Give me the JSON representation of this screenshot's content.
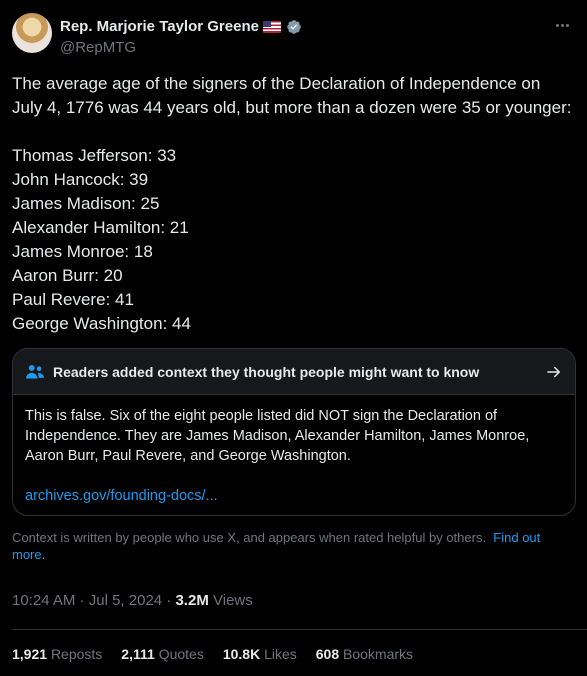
{
  "author": {
    "name": "Rep. Marjorie Taylor Greene",
    "handle": "@RepMTG"
  },
  "tweet": {
    "intro": "The average age of the signers of the Declaration of Independence on July 4, 1776 was 44 years old, but more than a dozen were 35 or younger:",
    "intro_line1": "The average age of the signers of the Declaration of Independence on",
    "intro_line2": "July 4, 1776 was 44 years old, but more than a dozen were 35 or younger:",
    "list": [
      "Thomas Jefferson: 33",
      "John Hancock: 39",
      "James Madison: 25",
      "Alexander Hamilton: 21",
      "James Monroe: 18",
      "Aaron Burr: 20",
      "Paul Revere: 41",
      "George Washington: 44"
    ]
  },
  "community_note": {
    "title": "Readers added context they thought people might want to know",
    "body_line1": "This is false. Six of the eight people listed did NOT sign the Declaration of",
    "body_line2": "Independence. They are James Madison, Alexander Hamilton, James Monroe,",
    "body_line3": "Aaron Burr, Paul Revere, and George Washington.",
    "link": "archives.gov/founding-docs/..."
  },
  "context_disclaimer": {
    "text": "Context is written by people who use X, and appears when rated helpful by others.",
    "find_out_more": "Find out more."
  },
  "meta": {
    "time": "10:24 AM",
    "separator": "·",
    "date": "Jul 5, 2024",
    "views_count": "3.2M",
    "views_label": "Views"
  },
  "stats": {
    "reposts_count": "1,921",
    "reposts_label": "Reposts",
    "quotes_count": "2,111",
    "quotes_label": "Quotes",
    "likes_count": "10.8K",
    "likes_label": "Likes",
    "bookmarks_count": "608",
    "bookmarks_label": "Bookmarks"
  },
  "colors": {
    "background": "#000000",
    "text": "#e7e9ea",
    "secondary": "#71767b",
    "link": "#1d9bf0",
    "border": "#2f3336"
  }
}
